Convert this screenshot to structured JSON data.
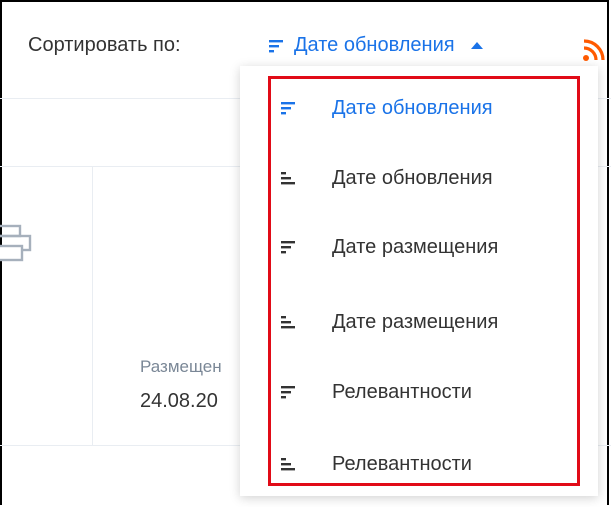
{
  "sort": {
    "label": "Сортировать по:",
    "current": "Дате обновления",
    "current_icon": "sort-desc-icon",
    "accent_color": "#1a73e8"
  },
  "result_card": {
    "placed_label": "Размещен",
    "placed_date": "24.08.20"
  },
  "dropdown": {
    "options": [
      {
        "label": "Дате обновления",
        "icon": "sort-desc-icon",
        "active": true
      },
      {
        "label": "Дате обновления",
        "icon": "sort-asc-icon",
        "active": false
      },
      {
        "label": "Дате размещения",
        "icon": "sort-desc-icon",
        "active": false
      },
      {
        "label": "Дате размещения",
        "icon": "sort-asc-icon",
        "active": false
      },
      {
        "label": "Релевантности",
        "icon": "sort-desc-icon",
        "active": false
      },
      {
        "label": "Релевантности",
        "icon": "sort-asc-icon",
        "active": false
      }
    ],
    "highlight_color": "#e10b17"
  },
  "icons": {
    "rss": "rss-icon",
    "print": "print-icon"
  }
}
